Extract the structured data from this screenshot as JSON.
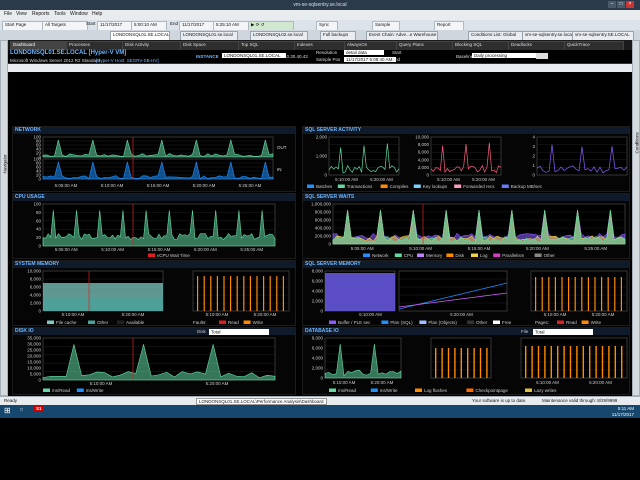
{
  "window_title": "vm-se-sqlsentry.se.local",
  "menu": [
    "File",
    "View",
    "Reports",
    "Tools",
    "Window",
    "Help"
  ],
  "toolbar": {
    "start_page": "Start Page",
    "all_targets": "All Targets",
    "start_label": "Start",
    "start_date": "11/17/2017",
    "start_time": "5:00:10 AM",
    "end_label": "End",
    "end_date": "11/17/2017",
    "end_time": "5:25:10 AM",
    "sync": "Sync",
    "sample": "Sample",
    "report": "Report"
  },
  "tabs_top": [
    "LONDONSQL01.SE.LOCAL",
    "LONDONSQL01.se.local",
    "LONDONSQL02.se.local",
    "Full backups",
    "Event Chain: Adve...e Warehouse Build",
    "Conditions List: Global",
    "vm-se-sqlsentry.se.local",
    "vm-se-sqlsentry.SE.LOCAL"
  ],
  "tabs_dash": [
    "Dashboard",
    "Processes",
    "Disk Activity",
    "Disk Space",
    "Top SQL",
    "Indexes",
    "AlwaysOn",
    "Query Plans",
    "Blocking SQL",
    "Deadlocks",
    "QuickTrace"
  ],
  "left_bar": "Navigator",
  "right_bar": "Conditions",
  "info": {
    "server": "LONDONSQL01.SE.LOCAL [Hyper-V VM]",
    "os": "Microsoft Windows Server 2012 R2 Standard",
    "host": "[Hyper-V Host: SEGRV-SB-HV]",
    "instance_label": "INSTANCE",
    "instance_value": "LONDONSQL01.SE.LOCAL",
    "ip": "10.30.40.43",
    "resolution_label": "Resolution",
    "resolution_value": "detail data",
    "sample_label": "Sample Pos",
    "sample_value": "11/17/2017 5:09:40 AM",
    "start_label": "Start",
    "end_label": "End",
    "baseline_label": "Baseline",
    "baseline_value": "Daily processing"
  },
  "panels": {
    "network": {
      "title": "NETWORK",
      "out": "OUT",
      "in": "IN",
      "y": [
        "100",
        "80",
        "60",
        "40",
        "20",
        "0"
      ],
      "x": [
        "5:05:00 AM",
        "5:10:00 AM",
        "5:15:00 AM",
        "5:20:00 AM",
        "5:25:00 AM"
      ]
    },
    "cpu": {
      "title": "CPU USAGE",
      "legend": [
        "vCPU Wait Time"
      ],
      "y": [
        "100",
        "80",
        "60",
        "40",
        "20",
        "0"
      ],
      "x": [
        "5:05:00 AM",
        "5:10:00 AM",
        "5:15:00 AM",
        "5:20:00 AM",
        "5:25:00 AM"
      ]
    },
    "memory": {
      "title": "SYSTEM MEMORY",
      "legend": [
        "File cache",
        "Other",
        "Available"
      ],
      "faults": "Faults:",
      "legend2": [
        "Read",
        "Write"
      ],
      "y": [
        "10,000",
        "8,000",
        "6,000",
        "4,000",
        "2,000",
        "0"
      ],
      "x": [
        "5:10:00 AM",
        "5:20:00 AM"
      ],
      "x2": [
        "5:10:00 AM",
        "5:20:00 AM"
      ]
    },
    "disk": {
      "title": "DISK IO",
      "disk_label": "Disk",
      "disk_value": "Total",
      "legend": [
        "ms/Read",
        "ms/Write"
      ],
      "y": [
        "35,000",
        "30,000",
        "25,000",
        "20,000",
        "15,000",
        "10,000",
        "5,000",
        "0"
      ],
      "x": [
        "5:10:00 AM",
        "5:20:00 AM"
      ]
    },
    "sql_activity": {
      "title": "SQL SERVER ACTIVITY",
      "legend": [
        "Batches",
        "Transactions",
        "Compiles",
        "Key lookups",
        "Forwarded recs",
        "Backup MB/sec"
      ],
      "y": [
        "2,000",
        "1,000",
        "0"
      ],
      "y2": [
        "10,000",
        "8,000",
        "6,000",
        "4,000",
        "2,000",
        "0"
      ],
      "y3": [
        "4",
        "3",
        "2",
        "1",
        "0"
      ],
      "x": [
        "5:10:00 AM",
        "5:20:00 AM"
      ]
    },
    "sql_waits": {
      "title": "SQL SERVER WAITS",
      "legend": [
        "Network",
        "CPU",
        "Memory",
        "Disk",
        "Log",
        "Parallelism",
        "Other"
      ],
      "y": [
        "1,000,000",
        "800,000",
        "600,000",
        "400,000",
        "200,000",
        "0"
      ],
      "x": [
        "5:05:00 AM",
        "5:10:00 AM",
        "5:15:00 AM",
        "5:20:00 AM",
        "5:25:00 AM"
      ]
    },
    "sql_memory": {
      "title": "SQL SERVER MEMORY",
      "legend": [
        "Buffer / PLE sec",
        "Plan (SQL)",
        "Plan (Objects)",
        "Other",
        "Free"
      ],
      "pages": "Pages:",
      "legend2": [
        "Read",
        "Write"
      ],
      "y": [
        "8,000",
        "6,000",
        "4,000",
        "2,000",
        "0"
      ],
      "x": [
        "5:10:00 AM",
        "5:20:00 AM"
      ]
    },
    "db_io": {
      "title": "DATABASE IO",
      "file_label": "File",
      "file_value": "Total",
      "legend": [
        "ms/Read",
        "ms/Write",
        "Log flushes",
        "Checkpointpage",
        "Lazy writes"
      ],
      "y": [
        "8,000",
        "6,000",
        "4,000",
        "2,000",
        "0"
      ],
      "x": [
        "5:10:00 AM",
        "5:20:00 AM"
      ]
    }
  },
  "status": {
    "ready": "Ready",
    "path": "LONDONSQL01.SE.LOCAL\\Performance Analysis\\Dashboard",
    "update": "Your software is up to date.",
    "maint": "Maintenance valid through: 8/29/9999"
  },
  "taskbar": {
    "time": "5:11 AM",
    "date": "11/17/2017"
  },
  "colors": {
    "green": "#62d9a3",
    "blue": "#1e90ff",
    "red": "#e02020",
    "orange": "#ff8a00",
    "purple": "#8a5cff",
    "yellow": "#f2d14b",
    "header_text": "#6fb6ff"
  }
}
